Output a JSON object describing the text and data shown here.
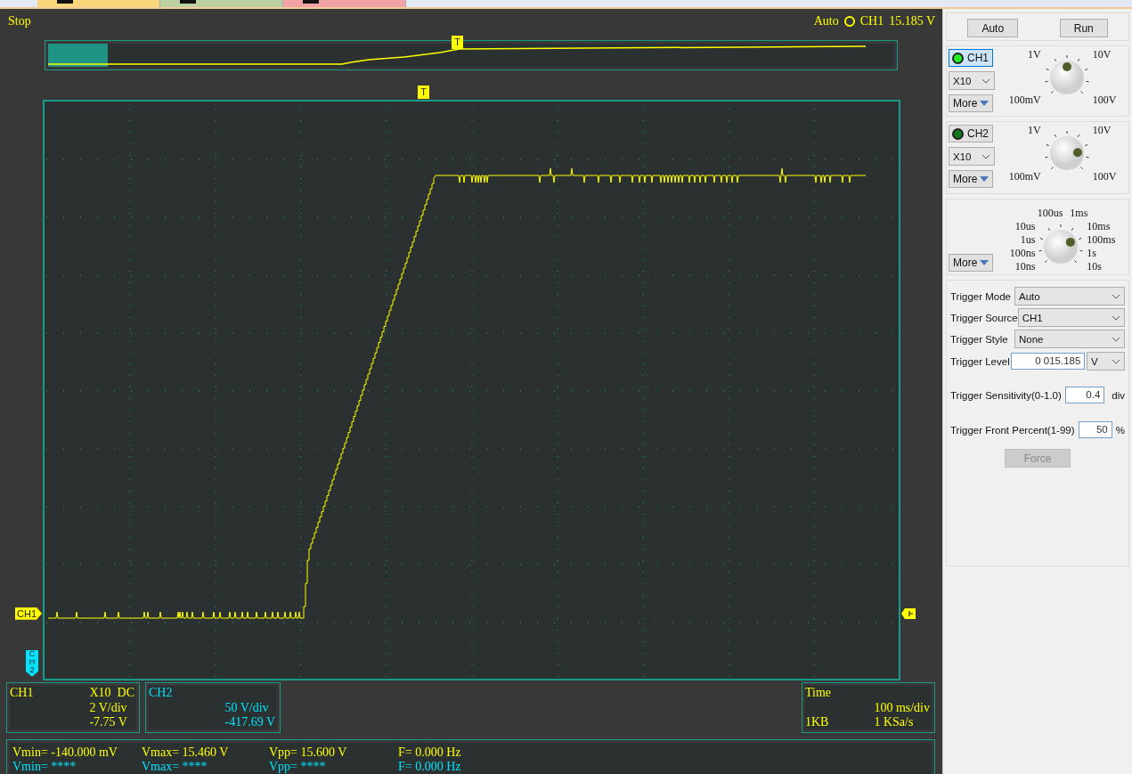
{
  "tabs": [
    {
      "color": "#f8d77c"
    },
    {
      "color": "#bdd0a0"
    },
    {
      "color": "#f2a4a4"
    }
  ],
  "status": {
    "run_state": "Stop",
    "trigger_mode": "Auto",
    "trigger_channel": "CH1",
    "trigger_value": "15.185 V"
  },
  "overview": {
    "level": 0.07,
    "marker": "T"
  },
  "plot": {
    "trigger_marker": "T",
    "ch1_marker": "CH1",
    "ch2_marker": "CH2"
  },
  "channel_info": [
    {
      "name": "CH1",
      "probe": "X10",
      "coupling": "DC",
      "scale": "2 V/div",
      "offset": "-7.75 V",
      "color": "#ffff00"
    },
    {
      "name": "CH2",
      "scale": "50 V/div",
      "offset": "-417.69 V",
      "color": "#00e5ff"
    }
  ],
  "time_info": {
    "title": "Time",
    "scale": "100 ms/div",
    "memory": "1KB",
    "rate": "1 KSa/s"
  },
  "measurements": [
    {
      "color": "#ffff00",
      "items": [
        "Vmin= -140.000 mV",
        "Vmax= 15.460 V",
        "Vpp= 15.600 V",
        "F= 0.000 Hz"
      ]
    },
    {
      "color": "#00e5ff",
      "items": [
        "Vmin= ****",
        "Vmax= ****",
        "Vpp= ****",
        "F= 0.000 Hz"
      ]
    }
  ],
  "panel": {
    "buttons": [
      "Auto",
      "Run"
    ],
    "channels": [
      {
        "label": "CH1",
        "on": true,
        "selected": true,
        "probe": "X10",
        "more": "More",
        "left": [
          "1V",
          "100mV"
        ],
        "right": [
          "10V",
          "100V"
        ]
      },
      {
        "label": "CH2",
        "on": false,
        "selected": false,
        "probe": "X10",
        "more": "More",
        "left": [
          "1V",
          "100mV"
        ],
        "right": [
          "10V",
          "100V"
        ]
      }
    ],
    "timebase": {
      "more": "More",
      "top": [
        "100us",
        "1ms"
      ],
      "left": [
        "10us",
        "1us",
        "100ns",
        "10ns"
      ],
      "right": [
        "10ms",
        "100ms",
        "1s",
        "10s"
      ]
    },
    "trigger": {
      "rows": [
        {
          "label": "Trigger Mode",
          "value": "Auto"
        },
        {
          "label": "Trigger Source",
          "value": "CH1"
        },
        {
          "label": "Trigger Style",
          "value": "None"
        }
      ],
      "level_label": "Trigger Level",
      "level_value": "0 015.185",
      "level_unit": "V",
      "sensitivity_label": "Trigger Sensitivity(0-1.0)",
      "sensitivity_value": "0.4",
      "sensitivity_unit": "div",
      "front_label": "Trigger Front Percent(1-99)",
      "front_value": "50",
      "front_unit": "%",
      "force": "Force",
      "force_disabled": true
    }
  }
}
